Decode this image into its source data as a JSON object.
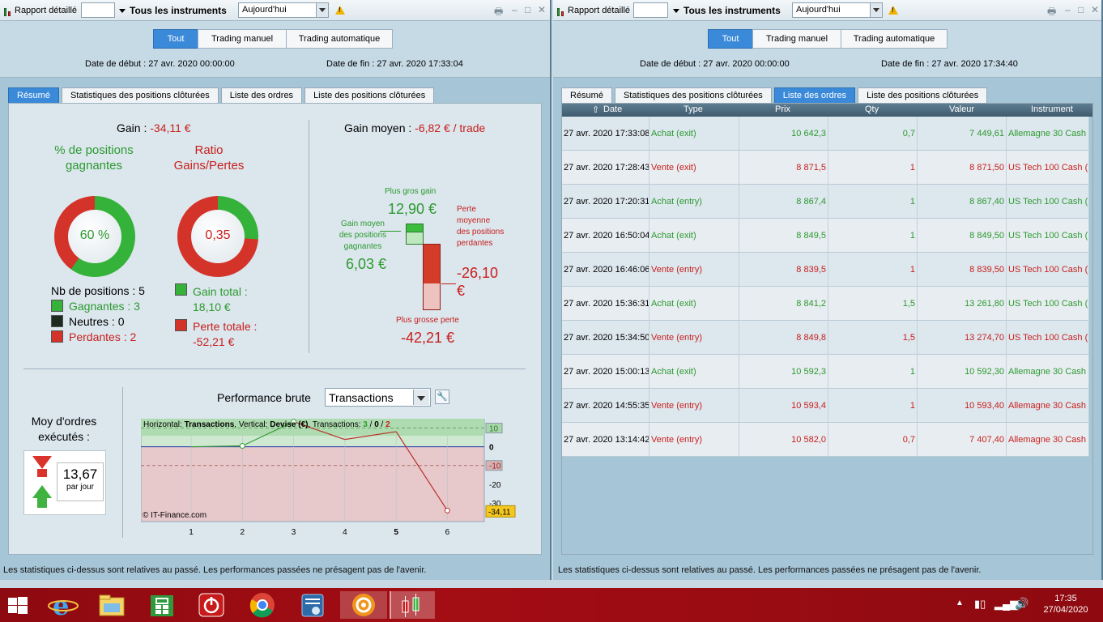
{
  "left": {
    "toolbar": {
      "report_label": "Rapport détaillé",
      "instruments": "Tous les instruments",
      "period": "Aujourd'hui"
    },
    "filter": {
      "buttons": [
        "Tout",
        "Trading manuel",
        "Trading automatique"
      ],
      "start_label": "Date de début :",
      "start_value": "27 avr. 2020 00:00:00",
      "end_label": "Date de fin :",
      "end_value": "27 avr. 2020 17:33:04"
    },
    "tabs": [
      "Résumé",
      "Statistiques des positions clôturées",
      "Liste des ordres",
      "Liste des positions clôturées"
    ],
    "summary": {
      "gain_label": "Gain :",
      "gain_value": "-34,11 €",
      "pct_title": "% de positions gagnantes",
      "pct_value": "60 %",
      "pct_fraction": 0.6,
      "ratio_title": "Ratio Gains/Pertes",
      "ratio_value": "0,35",
      "ratio_fraction": 0.26,
      "nb_positions": "Nb de positions : 5",
      "winners": "Gagnantes : 3",
      "neutral": "Neutres : 0",
      "losers": "Perdantes : 2",
      "gain_total_label": "Gain total :",
      "gain_total_value": "18,10 €",
      "perte_total_label": "Perte totale :",
      "perte_total_value": "-52,21 €",
      "avg_gain_label": "Gain moyen :",
      "avg_gain_value": "-6,82 € / trade",
      "best_gain_label": "Plus gros gain",
      "best_gain_value": "12,90 €",
      "avg_win_label": "Gain moyen des positions gagnantes",
      "avg_win_value": "6,03 €",
      "avg_loss_label": "Perte moyenne des positions perdantes",
      "avg_loss_value": "-26,10 €",
      "worst_loss_label": "Plus grosse perte",
      "worst_loss_value": "-42,21 €"
    },
    "orders": {
      "label": "Moy d'ordres exécutés :",
      "value": "13,67",
      "unit": "par jour"
    },
    "perf": {
      "title": "Performance brute",
      "select": "Transactions",
      "legend_h": "Horizontal:",
      "legend_h_val": "Transactions",
      "legend_v": ", Vertical:",
      "legend_v_val": "Devise (€)",
      "legend_t": ", Transactions:",
      "legend_n1": "3",
      "legend_sep1": "/",
      "legend_n2": "0",
      "legend_sep2": "/",
      "legend_n3": "2",
      "copyright": "© IT-Finance.com",
      "last_label": "-34,11"
    },
    "footer": "Les statistiques ci-dessus sont relatives au passé. Les performances passées ne présagent pas de l'avenir."
  },
  "chart_data": {
    "type": "line",
    "x": [
      0,
      1,
      2,
      3,
      4,
      5
    ],
    "y": [
      0,
      0.5,
      13.4,
      3.9,
      8.1,
      -34.11
    ],
    "xticks": [
      "1",
      "2",
      "3",
      "4",
      "5",
      "6"
    ],
    "yticks": [
      "10",
      "0",
      "-10",
      "-20",
      "-30"
    ],
    "ylim": [
      -40,
      15
    ]
  },
  "right": {
    "toolbar": {
      "report_label": "Rapport détaillé",
      "instruments": "Tous les instruments",
      "period": "Aujourd'hui"
    },
    "filter": {
      "buttons": [
        "Tout",
        "Trading manuel",
        "Trading automatique"
      ],
      "start_label": "Date de début :",
      "start_value": "27 avr. 2020 00:00:00",
      "end_label": "Date de fin :",
      "end_value": "27 avr. 2020 17:34:40"
    },
    "tabs": [
      "Résumé",
      "Statistiques des positions clôturées",
      "Liste des ordres",
      "Liste des positions clôturées"
    ],
    "columns": [
      "Date",
      "Type",
      "Prix",
      "Qty",
      "Valeur",
      "Instrument"
    ],
    "rows": [
      {
        "date": "27 avr. 2020 17:33:08",
        "type": "Achat (exit)",
        "prix": "10 642,3",
        "qty": "0,7",
        "valeur": "7 449,61",
        "instr": "Allemagne 30 Cash ...",
        "side": "buy"
      },
      {
        "date": "27 avr. 2020 17:28:43",
        "type": "Vente (exit)",
        "prix": "8 871,5",
        "qty": "1",
        "valeur": "8 871,50",
        "instr": "US Tech 100 Cash (...",
        "side": "sell"
      },
      {
        "date": "27 avr. 2020 17:20:31",
        "type": "Achat (entry)",
        "prix": "8 867,4",
        "qty": "1",
        "valeur": "8 867,40",
        "instr": "US Tech 100 Cash (...",
        "side": "buy"
      },
      {
        "date": "27 avr. 2020 16:50:04",
        "type": "Achat (exit)",
        "prix": "8 849,5",
        "qty": "1",
        "valeur": "8 849,50",
        "instr": "US Tech 100 Cash (...",
        "side": "buy"
      },
      {
        "date": "27 avr. 2020 16:46:06",
        "type": "Vente (entry)",
        "prix": "8 839,5",
        "qty": "1",
        "valeur": "8 839,50",
        "instr": "US Tech 100 Cash (...",
        "side": "sell"
      },
      {
        "date": "27 avr. 2020 15:36:31",
        "type": "Achat (exit)",
        "prix": "8 841,2",
        "qty": "1,5",
        "valeur": "13 261,80",
        "instr": "US Tech 100 Cash (...",
        "side": "buy"
      },
      {
        "date": "27 avr. 2020 15:34:50",
        "type": "Vente (entry)",
        "prix": "8 849,8",
        "qty": "1,5",
        "valeur": "13 274,70",
        "instr": "US Tech 100 Cash (...",
        "side": "sell"
      },
      {
        "date": "27 avr. 2020 15:00:13",
        "type": "Achat (exit)",
        "prix": "10 592,3",
        "qty": "1",
        "valeur": "10 592,30",
        "instr": "Allemagne 30 Cash ...",
        "side": "buy"
      },
      {
        "date": "27 avr. 2020 14:55:35",
        "type": "Vente (entry)",
        "prix": "10 593,4",
        "qty": "1",
        "valeur": "10 593,40",
        "instr": "Allemagne 30 Cash ...",
        "side": "sell"
      },
      {
        "date": "27 avr. 2020 13:14:42",
        "type": "Vente (entry)",
        "prix": "10 582,0",
        "qty": "0,7",
        "valeur": "7 407,40",
        "instr": "Allemagne 30 Cash ...",
        "side": "sell"
      }
    ],
    "footer": "Les statistiques ci-dessus sont relatives au passé. Les performances passées ne présagent pas de l'avenir."
  },
  "taskbar": {
    "apps": [
      "windows-start-icon",
      "internet-explorer-icon",
      "file-explorer-icon",
      "store-icon",
      "power-app-icon",
      "chrome-icon",
      "control-panel-icon",
      "settings-wheel-icon",
      "trading-app-icon"
    ],
    "time": "17:35",
    "date": "27/04/2020"
  },
  "colors": {
    "accent": "#3b8ad9",
    "gain": "#2c9a2f",
    "loss": "#c8201d",
    "taskbar": "#a40d14"
  }
}
